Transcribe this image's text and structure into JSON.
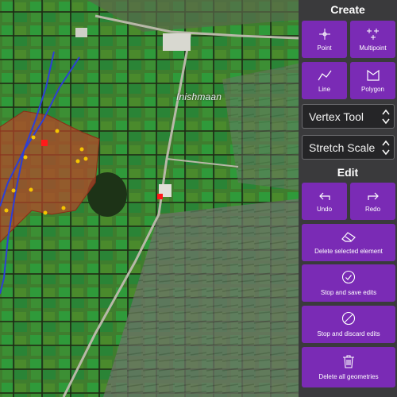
{
  "map": {
    "place_label": "Inishmaan"
  },
  "panel": {
    "create_title": "Create",
    "edit_title": "Edit",
    "create_tools": [
      {
        "label": "Point",
        "icon": "point-icon"
      },
      {
        "label": "Multipoint",
        "icon": "multipoint-icon"
      },
      {
        "label": "Line",
        "icon": "line-icon"
      },
      {
        "label": "Polygon",
        "icon": "polygon-icon"
      }
    ],
    "vertex_tool": "Vertex Tool",
    "stretch_scale": "Stretch Scale",
    "undo_label": "Undo",
    "redo_label": "Redo",
    "delete_selected_label": "Delete selected element",
    "stop_save_label": "Stop and save edits",
    "stop_discard_label": "Stop and discard edits",
    "delete_all_label": "Delete all geometries"
  },
  "colors": {
    "accent": "#7a2bb5",
    "panel_bg": "#3a3a3c",
    "polygon_fill": "#b8452a",
    "line_stroke": "#2d3fd6",
    "vertex_point": "#f5c400",
    "selected_point": "#ff1a1a"
  }
}
